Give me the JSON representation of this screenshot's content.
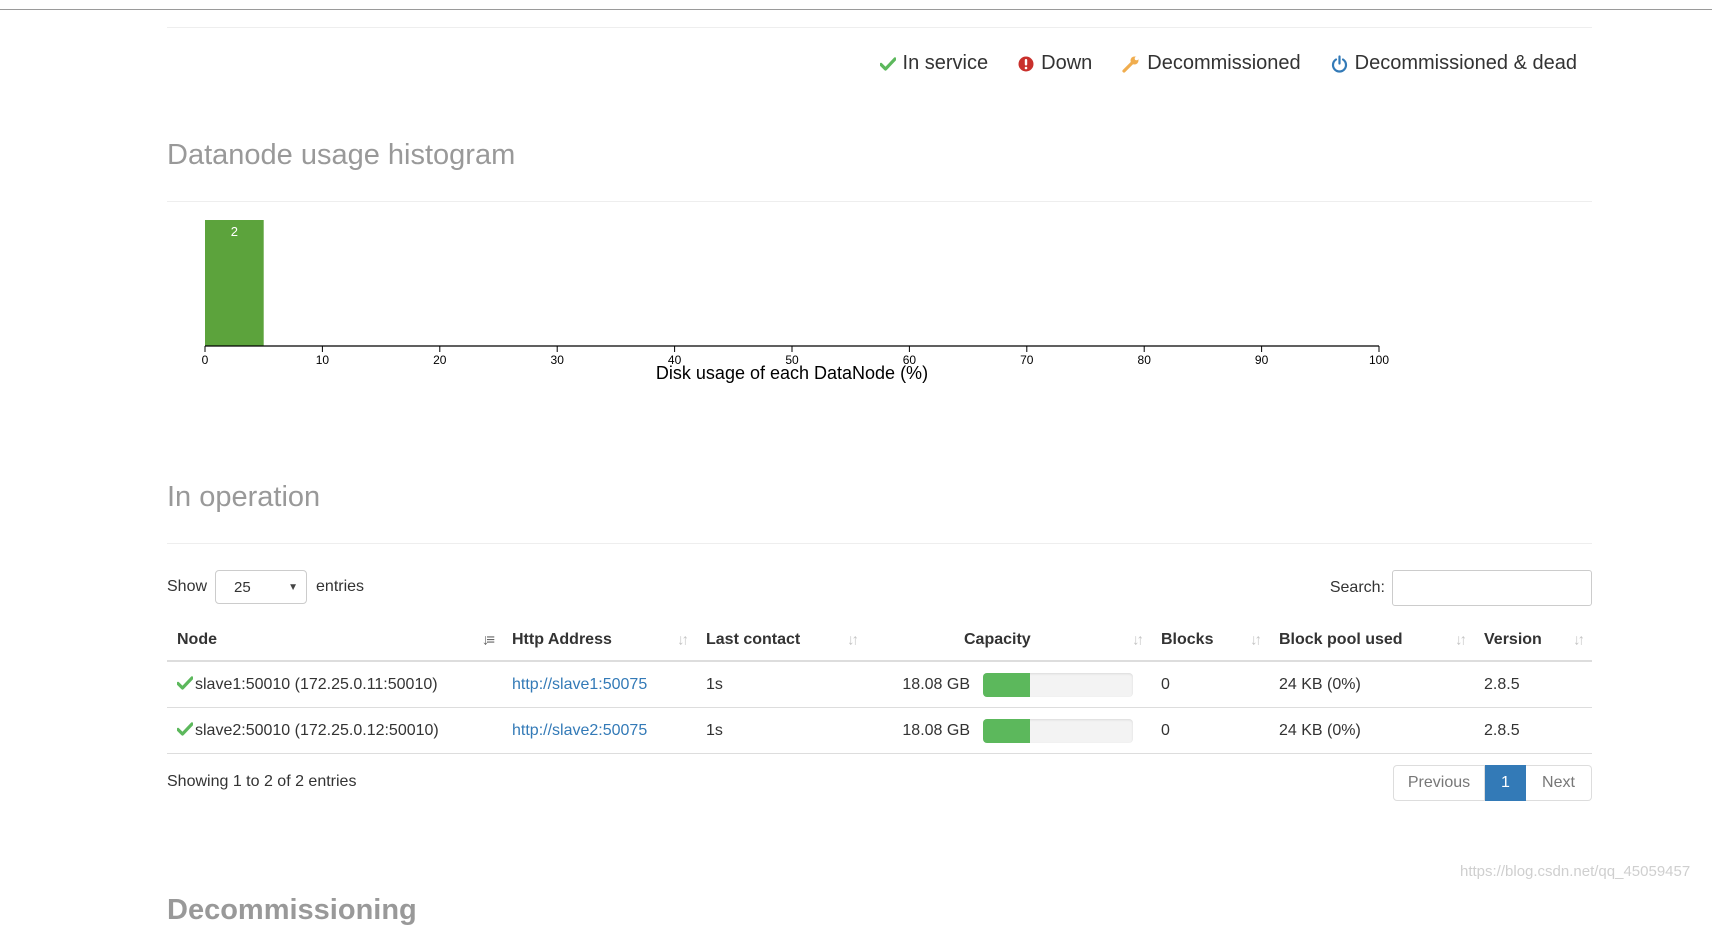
{
  "legend": {
    "in_service": "In service",
    "down": "Down",
    "decommissioned": "Decommissioned",
    "decommissioned_dead": "Decommissioned & dead",
    "colors": {
      "in_service": "#5cb85c",
      "down": "#c9302c",
      "decommissioned": "#f0ad4e",
      "dead": "#337ab7"
    },
    "icons": [
      "check-icon",
      "exclamation-circle-icon",
      "wrench-icon",
      "power-icon"
    ]
  },
  "histogram": {
    "title": "Datanode usage histogram"
  },
  "chart_data": {
    "type": "bar",
    "title": "",
    "xlabel": "Disk usage of each DataNode (%)",
    "ylabel": "",
    "xlim": [
      0,
      100
    ],
    "x_ticks": [
      0,
      10,
      20,
      30,
      40,
      50,
      60,
      70,
      80,
      90,
      100
    ],
    "bins": [
      {
        "x0": 0,
        "x1": 5,
        "count": 2,
        "label": "2"
      }
    ],
    "bar_color": "#5ca33c",
    "grid": false
  },
  "operation": {
    "title": "In operation",
    "show_label": "Show",
    "entries_label": "entries",
    "page_size": "25",
    "search_label": "Search:",
    "search_value": "",
    "columns": [
      "Node",
      "Http Address",
      "Last contact",
      "Capacity",
      "Blocks",
      "Block pool used",
      "Version"
    ],
    "rows": [
      {
        "node": "slave1:50010 (172.25.0.11:50010)",
        "http": "http://slave1:50075",
        "last_contact": "1s",
        "capacity": "18.08 GB",
        "usage_percent": 31,
        "blocks": "0",
        "block_pool_used": "24 KB (0%)",
        "version": "2.8.5"
      },
      {
        "node": "slave2:50010 (172.25.0.12:50010)",
        "http": "http://slave2:50075",
        "last_contact": "1s",
        "capacity": "18.08 GB",
        "usage_percent": 31,
        "blocks": "0",
        "block_pool_used": "24 KB (0%)",
        "version": "2.8.5"
      }
    ],
    "info": "Showing 1 to 2 of 2 entries",
    "pagination": {
      "previous": "Previous",
      "current": "1",
      "next": "Next"
    }
  },
  "decommissioning": {
    "title": "Decommissioning"
  },
  "watermark": "https://blog.csdn.net/qq_45059457"
}
